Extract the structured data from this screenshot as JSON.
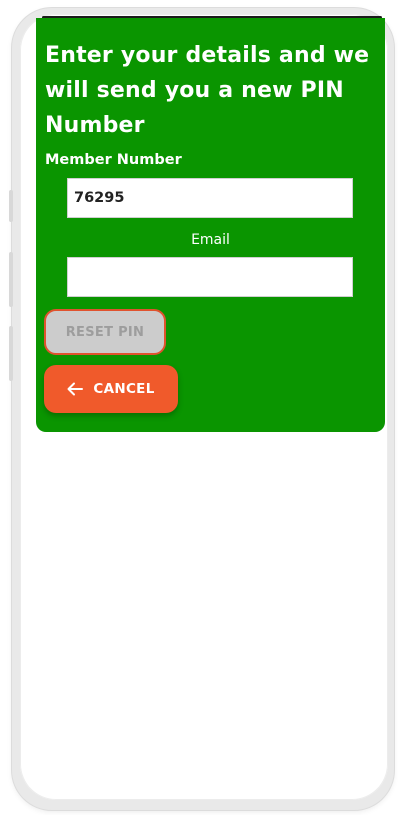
{
  "form": {
    "title": "Enter your details and we will send you a new PIN Number",
    "member_number_label": "Member Number",
    "member_number_value": "76295",
    "email_label": "Email",
    "email_value": "",
    "reset_button_label": "RESET PIN",
    "cancel_button_label": "CANCEL"
  },
  "icons": {
    "cancel_icon": "arrow-left-icon"
  },
  "colors": {
    "card_background": "#0a9500",
    "cancel_button": "#f05a2b",
    "reset_button_disabled": "#cccccc",
    "reset_button_border": "#e0522e"
  }
}
